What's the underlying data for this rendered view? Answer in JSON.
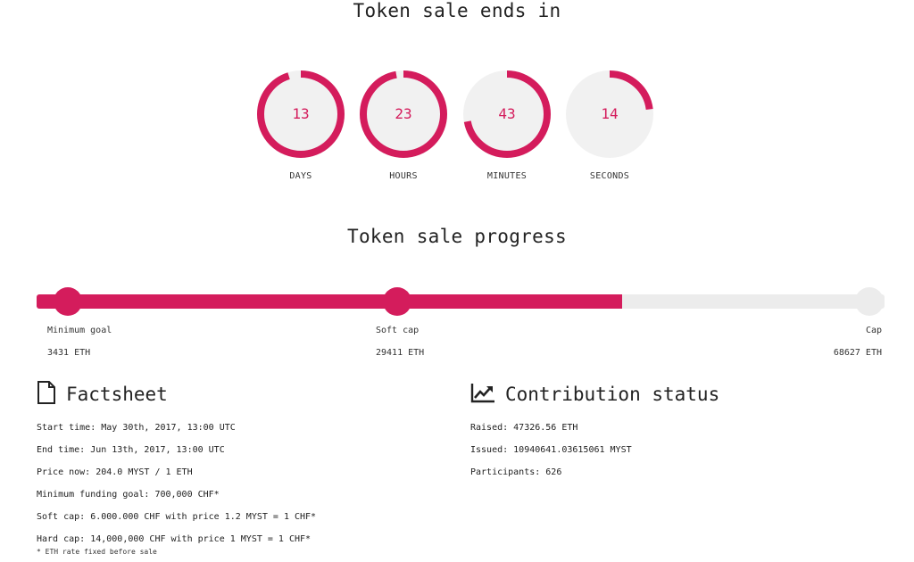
{
  "countdown": {
    "title": "Token sale ends in",
    "accent": "#d41c5c",
    "ring_bg": "#f1f1f1",
    "units": [
      {
        "value": "13",
        "label": "DAYS",
        "fraction": 0.95
      },
      {
        "value": "23",
        "label": "HOURS",
        "fraction": 0.97
      },
      {
        "value": "43",
        "label": "MINUTES",
        "fraction": 0.72
      },
      {
        "value": "14",
        "label": "SECONDS",
        "fraction": 0.23
      }
    ]
  },
  "progress": {
    "title": "Token sale progress",
    "fill_fraction": 0.69,
    "accent": "#d41c5c",
    "track_color": "#ececec",
    "milestones": [
      {
        "name": "Minimum goal",
        "amount": "3431 ETH",
        "position_fraction": 0.037,
        "reached": true
      },
      {
        "name": "Soft cap",
        "amount": "29411 ETH",
        "position_fraction": 0.425,
        "reached": true
      },
      {
        "name": "Cap",
        "amount": "68627 ETH",
        "position_fraction": 0.982,
        "reached": false
      }
    ]
  },
  "factsheet": {
    "title": "Factsheet",
    "icon": "document-icon",
    "items": [
      "Start time: May 30th, 2017, 13:00 UTC",
      "End time: Jun 13th, 2017, 13:00 UTC",
      "Price now: 204.0 MYST / 1 ETH",
      "Minimum funding goal: 700,000 CHF*",
      "Soft cap: 6.000.000 CHF with price 1.2 MYST = 1 CHF*",
      "Hard cap: 14,000,000 CHF with price 1 MYST = 1 CHF*"
    ],
    "footnote": "* ETH rate fixed before sale"
  },
  "contribution": {
    "title": "Contribution status",
    "icon": "line-chart-icon",
    "items": [
      "Raised: 47326.56 ETH",
      "Issued: 10940641.03615061 MYST",
      "Participants: 626"
    ]
  }
}
